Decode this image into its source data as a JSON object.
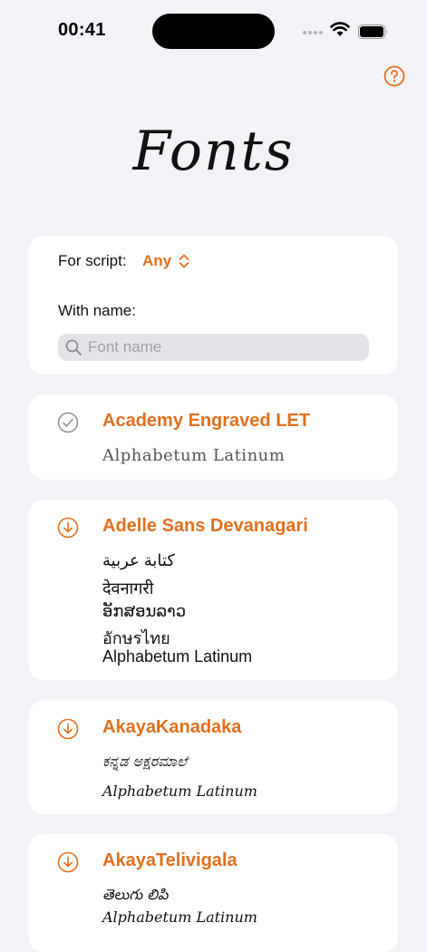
{
  "status_bar": {
    "time": "00:41"
  },
  "header": {
    "title": "Fonts"
  },
  "filter": {
    "script_label": "For script:",
    "script_value": "Any",
    "name_label": "With name:",
    "search_placeholder": "Font name",
    "search_value": ""
  },
  "fonts": [
    {
      "name": "Academy Engraved LET",
      "status": "installed",
      "samples": [
        "Alphabetum Latinum"
      ]
    },
    {
      "name": "Adelle Sans Devanagari",
      "status": "download",
      "samples": [
        "كتابة عربية",
        "देवनागरी",
        "ອັກສອນລາວ",
        "อักษรไทย",
        "Alphabetum Latinum"
      ]
    },
    {
      "name": "AkayaKanadaka",
      "status": "download",
      "samples": [
        "ಕನ್ನಡ ಅಕ್ಷರಮಾಲೆ",
        "Alphabetum Latinum"
      ]
    },
    {
      "name": "AkayaTelivigala",
      "status": "download",
      "samples": [
        "తెలుగు లిపి",
        "Alphabetum Latinum"
      ]
    }
  ],
  "colors": {
    "accent": "#e0701e",
    "background": "#f2f2f7",
    "card": "#ffffff"
  }
}
